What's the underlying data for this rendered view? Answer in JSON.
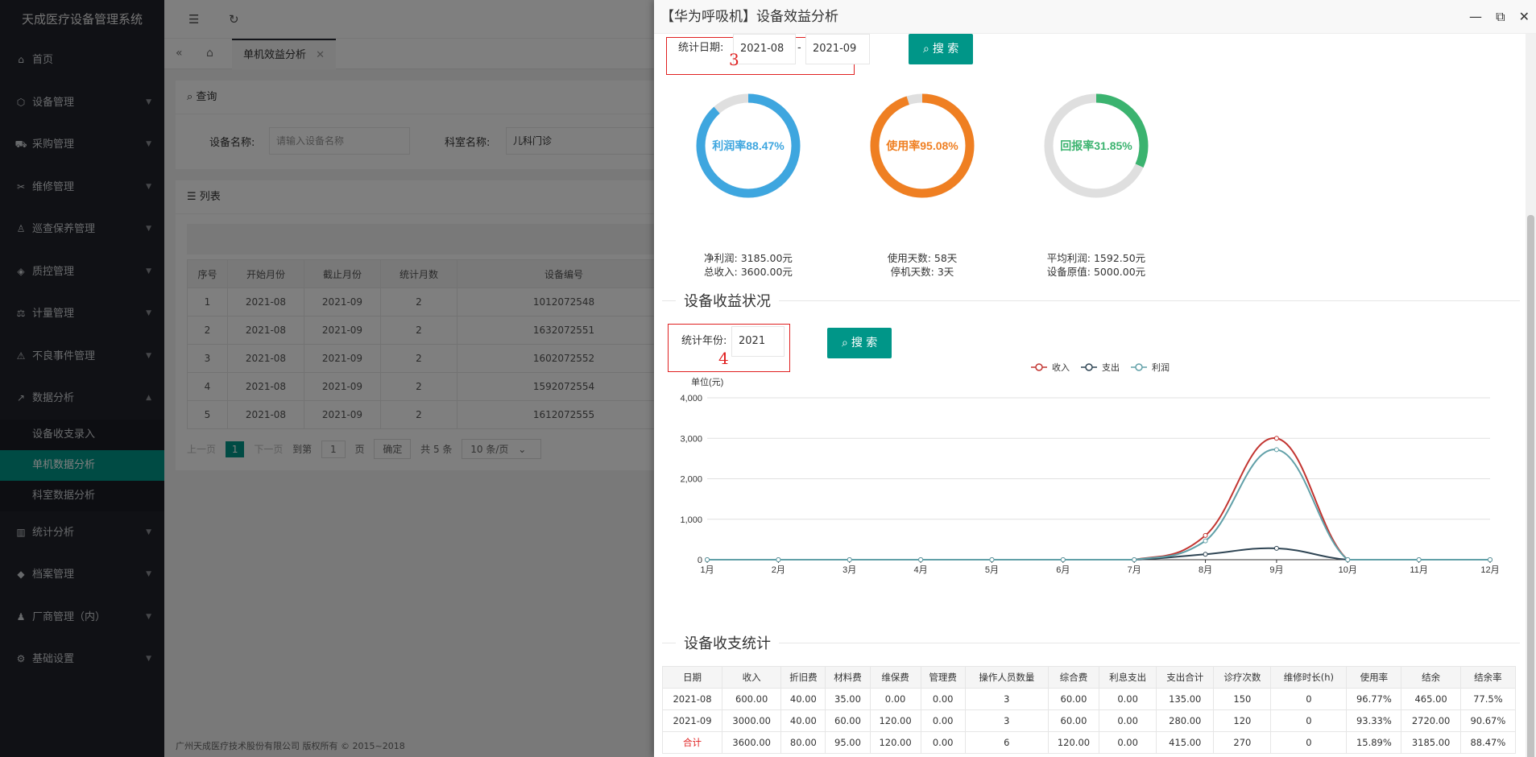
{
  "app_title": "天成医疗设备管理系统",
  "sidebar": {
    "items": [
      {
        "icon": "home-icon",
        "glyph": "⌂",
        "label": "首页",
        "arrow": false
      },
      {
        "icon": "box-icon",
        "glyph": "⬡",
        "label": "设备管理",
        "arrow": true
      },
      {
        "icon": "cart-icon",
        "glyph": "⛟",
        "label": "采购管理",
        "arrow": true
      },
      {
        "icon": "wrench-icon",
        "glyph": "✂",
        "label": "维修管理",
        "arrow": true
      },
      {
        "icon": "person-icon",
        "glyph": "♙",
        "label": "巡查保养管理",
        "arrow": true
      },
      {
        "icon": "shield-icon",
        "glyph": "◈",
        "label": "质控管理",
        "arrow": true
      },
      {
        "icon": "scale-icon",
        "glyph": "⚖",
        "label": "计量管理",
        "arrow": true
      },
      {
        "icon": "warning-icon",
        "glyph": "⚠",
        "label": "不良事件管理",
        "arrow": true
      },
      {
        "icon": "trend-icon",
        "glyph": "↗",
        "label": "数据分析",
        "arrow": true
      }
    ],
    "sub_items": [
      {
        "label": "设备收支录入",
        "active": false
      },
      {
        "label": "单机数据分析",
        "active": true
      },
      {
        "label": "科室数据分析",
        "active": false
      }
    ],
    "items2": [
      {
        "icon": "bar-chart-icon",
        "glyph": "▥",
        "label": "统计分析",
        "arrow": true
      },
      {
        "icon": "layers-icon",
        "glyph": "◆",
        "label": "档案管理",
        "arrow": true
      },
      {
        "icon": "users-icon",
        "glyph": "♟",
        "label": "厂商管理（内）",
        "arrow": true
      },
      {
        "icon": "settings-icon",
        "glyph": "⚙",
        "label": "基础设置",
        "arrow": true
      }
    ]
  },
  "tabs": {
    "active_label": "单机效益分析"
  },
  "query_card": {
    "title": "查询",
    "device_name_label": "设备名称:",
    "device_name_placeholder": "请输入设备名称",
    "dept_label": "科室名称:",
    "dept_value": "儿科门诊"
  },
  "list_card": {
    "title": "列表",
    "headers": [
      "序号",
      "开始月份",
      "截止月份",
      "统计月数",
      "设备编号"
    ],
    "rows": [
      [
        "1",
        "2021-08",
        "2021-09",
        "2",
        "1012072548"
      ],
      [
        "2",
        "2021-08",
        "2021-09",
        "2",
        "1632072551"
      ],
      [
        "3",
        "2021-08",
        "2021-09",
        "2",
        "1602072552"
      ],
      [
        "4",
        "2021-08",
        "2021-09",
        "2",
        "1592072554"
      ],
      [
        "5",
        "2021-08",
        "2021-09",
        "2",
        "1612072555"
      ]
    ],
    "pager": {
      "prev": "上一页",
      "current": "1",
      "next": "下一页",
      "goto": "到第",
      "page_input": "1",
      "page_unit": "页",
      "confirm": "确定",
      "total": "共 5 条",
      "page_size": "10 条/页"
    }
  },
  "footer": "广州天成医疗技术股份有限公司 版权所有 © 2015~2018",
  "modal": {
    "title": "【华为呼吸机】设备效益分析",
    "date_filter": {
      "label": "统计日期:",
      "start": "2021-08",
      "sep": "-",
      "end": "2021-09",
      "search": "搜 索",
      "annotation": "3"
    },
    "donuts": [
      {
        "label": "利润率88.47%",
        "percent": 88.47,
        "color": "#3ea6df",
        "line1": "净利润:  3185.00元",
        "line2": "总收入:  3600.00元"
      },
      {
        "label": "使用率95.08%",
        "percent": 95.08,
        "color": "#ef7f22",
        "line1": "使用天数:  58天",
        "line2": "停机天数:  3天"
      },
      {
        "label": "回报率31.85%",
        "percent": 31.85,
        "color": "#3bb36f",
        "line1": "平均利润:  1592.50元",
        "line2": "设备原值:  5000.00元"
      }
    ],
    "section_income": "设备收益状况",
    "year_filter": {
      "label": "统计年份:",
      "value": "2021",
      "search": "搜 索",
      "annotation": "4"
    },
    "section_stats": "设备收支统计",
    "stats_table": {
      "headers": [
        "日期",
        "收入",
        "折旧费",
        "材料费",
        "维保费",
        "管理费",
        "操作人员数量",
        "综合费",
        "利息支出",
        "支出合计",
        "诊疗次数",
        "维修时长(h)",
        "使用率",
        "结余",
        "结余率"
      ],
      "rows": [
        [
          "2021-08",
          "600.00",
          "40.00",
          "35.00",
          "0.00",
          "0.00",
          "3",
          "60.00",
          "0.00",
          "135.00",
          "150",
          "0",
          "96.77%",
          "465.00",
          "77.5%"
        ],
        [
          "2021-09",
          "3000.00",
          "40.00",
          "60.00",
          "120.00",
          "0.00",
          "3",
          "60.00",
          "0.00",
          "280.00",
          "120",
          "0",
          "93.33%",
          "2720.00",
          "90.67%"
        ],
        [
          "合计",
          "3600.00",
          "80.00",
          "95.00",
          "120.00",
          "0.00",
          "6",
          "120.00",
          "0.00",
          "415.00",
          "270",
          "0",
          "15.89%",
          "3185.00",
          "88.47%"
        ]
      ]
    }
  },
  "chart_data": {
    "type": "line",
    "ylabel": "单位(元)",
    "ylim": [
      0,
      4000
    ],
    "yticks": [
      "0",
      "1,000",
      "2,000",
      "3,000",
      "4,000"
    ],
    "categories": [
      "1月",
      "2月",
      "3月",
      "4月",
      "5月",
      "6月",
      "7月",
      "8月",
      "9月",
      "10月",
      "11月",
      "12月"
    ],
    "series": [
      {
        "name": "收入",
        "color": "#c23531",
        "values": [
          0,
          0,
          0,
          0,
          0,
          0,
          0,
          600,
          3000,
          0,
          0,
          0
        ]
      },
      {
        "name": "支出",
        "color": "#2f4554",
        "values": [
          0,
          0,
          0,
          0,
          0,
          0,
          0,
          135,
          280,
          0,
          0,
          0
        ]
      },
      {
        "name": "利润",
        "color": "#61a0a8",
        "values": [
          0,
          0,
          0,
          0,
          0,
          0,
          0,
          465,
          2720,
          0,
          0,
          0
        ]
      }
    ],
    "legend_position": "top-center",
    "grid": true
  }
}
